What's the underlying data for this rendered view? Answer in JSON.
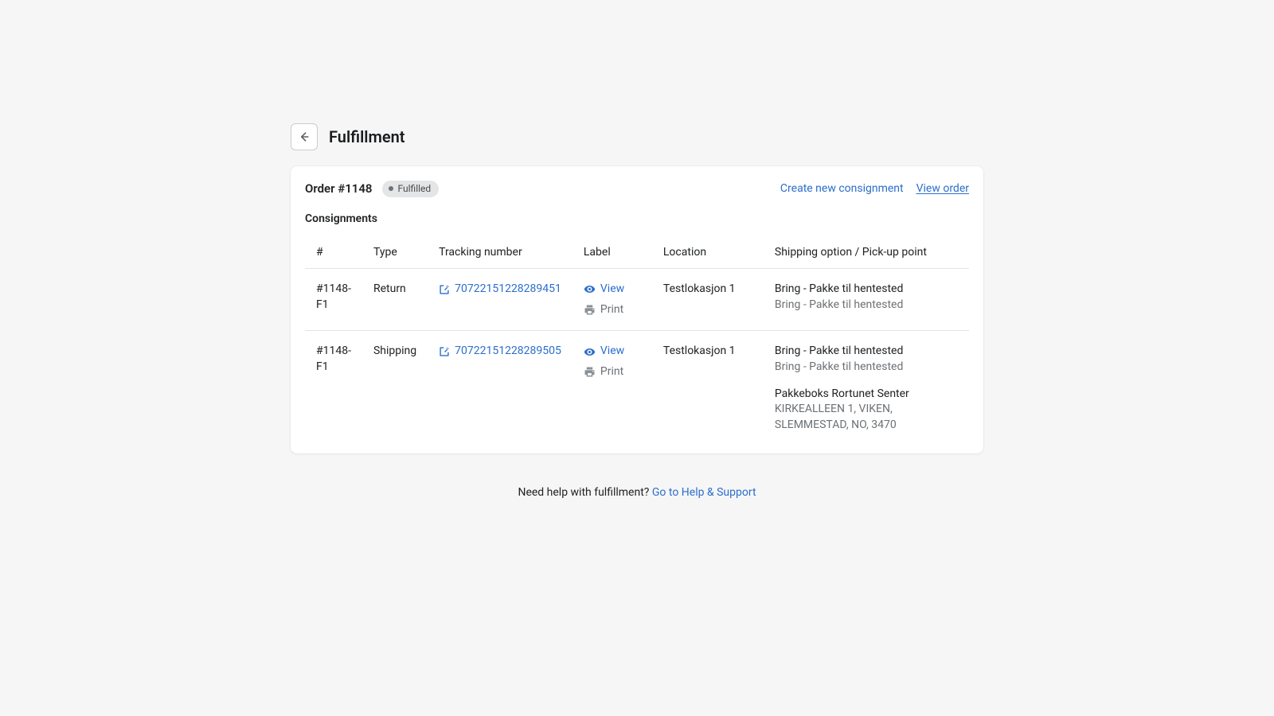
{
  "page": {
    "title": "Fulfillment"
  },
  "card": {
    "order_title": "Order #1148",
    "badge_text": "Fulfilled",
    "create_link": "Create new consignment",
    "view_order_link": "View order",
    "section_title": "Consignments"
  },
  "table": {
    "headers": {
      "id": "#",
      "type": "Type",
      "tracking": "Tracking number",
      "label": "Label",
      "location": "Location",
      "shipping": "Shipping option / Pick-up point"
    }
  },
  "rows": [
    {
      "id": "#1148-F1",
      "type": "Return",
      "tracking": "70722151228289451",
      "view_label": "View",
      "print_label": "Print",
      "location": "Testlokasjon 1",
      "ship_main": "Bring - Pakke til hentested",
      "ship_sub": "Bring - Pakke til hentested",
      "pickup_name": "",
      "pickup_addr": ""
    },
    {
      "id": "#1148-F1",
      "type": "Shipping",
      "tracking": "70722151228289505",
      "view_label": "View",
      "print_label": "Print",
      "location": "Testlokasjon 1",
      "ship_main": "Bring - Pakke til hentested",
      "ship_sub": "Bring - Pakke til hentested",
      "pickup_name": "Pakkeboks Rortunet Senter",
      "pickup_addr": "KIRKEALLEEN 1, VIKEN, SLEMMESTAD, NO, 3470"
    }
  ],
  "footer": {
    "help_text": "Need help with fulfillment? ",
    "help_link": "Go to Help & Support"
  }
}
